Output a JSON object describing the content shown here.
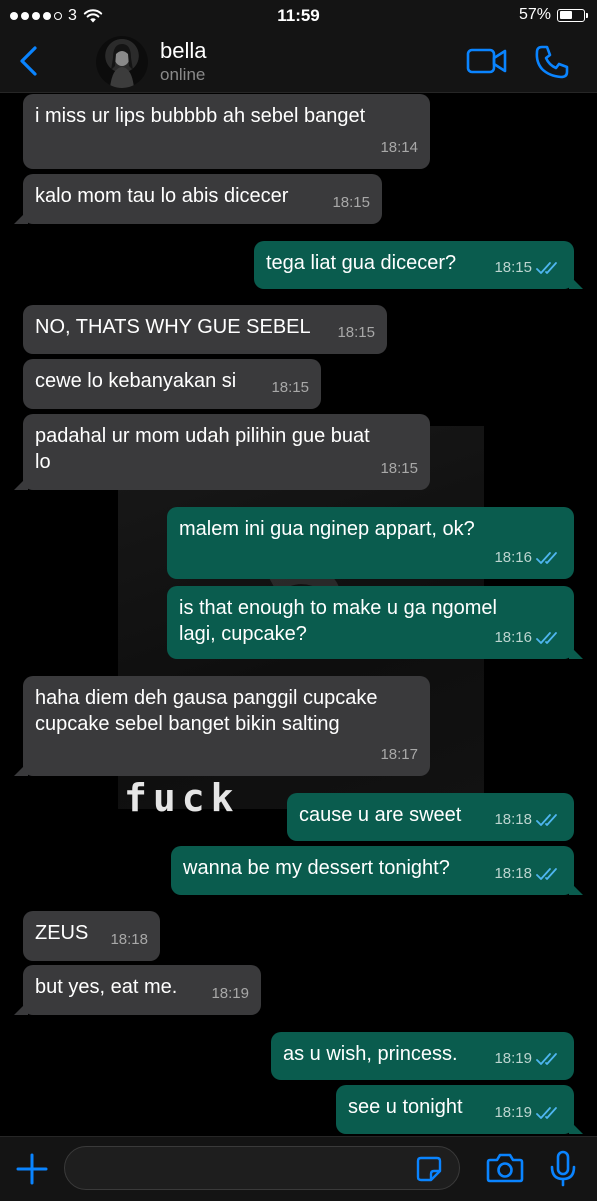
{
  "status_bar": {
    "carrier": "3",
    "signal_bars": 4,
    "time": "11:59",
    "battery": "57%",
    "battery_level": 0.57
  },
  "contact": {
    "name": "bella",
    "status": "online"
  },
  "icons": {
    "back": "back-chevron-icon",
    "video": "video-call-icon",
    "phone": "phone-call-icon",
    "plus": "plus-icon",
    "sticker": "sticker-icon",
    "camera": "camera-icon",
    "mic": "microphone-icon",
    "read": "double-check-icon"
  },
  "colors": {
    "accent": "#0a84ff",
    "incoming": "#3a3a3c",
    "outgoing": "#0a5c4e",
    "read_ticks": "#4fb6f0",
    "background": "#000000"
  },
  "background_image_text": "fuck",
  "messages": [
    {
      "dir": "in",
      "text": "i miss ur lips bubbbb ah sebel banget",
      "time": "18:14",
      "read": false
    },
    {
      "dir": "in",
      "text": "kalo mom tau lo abis dicecer",
      "time": "18:15",
      "read": false
    },
    {
      "dir": "out",
      "text": "tega liat gua dicecer?",
      "time": "18:15",
      "read": true
    },
    {
      "dir": "in",
      "text": "NO, THATS WHY GUE SEBEL",
      "time": "18:15",
      "read": false
    },
    {
      "dir": "in",
      "text": "cewe lo kebanyakan si",
      "time": "18:15",
      "read": false
    },
    {
      "dir": "in",
      "text": "padahal ur mom udah pilihin gue buat\nlo",
      "time": "18:15",
      "read": false
    },
    {
      "dir": "out",
      "text": "malem ini gua nginep appart, ok?",
      "time": "18:16",
      "read": true
    },
    {
      "dir": "out",
      "text": "is that enough to make u ga ngomel\nlagi, cupcake?",
      "time": "18:16",
      "read": true
    },
    {
      "dir": "in",
      "text": "haha diem deh gausa panggil cupcake\ncupcake sebel banget bikin salting",
      "time": "18:17",
      "read": false
    },
    {
      "dir": "out",
      "text": "cause u are sweet",
      "time": "18:18",
      "read": true
    },
    {
      "dir": "out",
      "text": "wanna be my dessert tonight?",
      "time": "18:18",
      "read": true
    },
    {
      "dir": "in",
      "text": "ZEUS",
      "time": "18:18",
      "read": false
    },
    {
      "dir": "in",
      "text": "but yes, eat me.",
      "time": "18:19",
      "read": false
    },
    {
      "dir": "out",
      "text": "as u wish, princess.",
      "time": "18:19",
      "read": true
    },
    {
      "dir": "out",
      "text": "see u tonight",
      "time": "18:19",
      "read": true
    }
  ]
}
